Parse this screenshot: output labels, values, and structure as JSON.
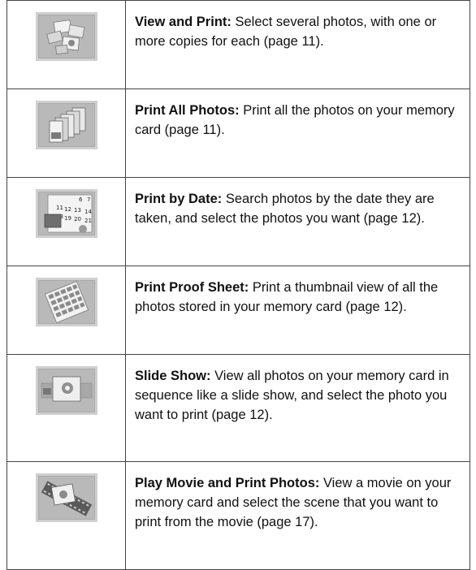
{
  "rows": [
    {
      "icon": "view-and-print-icon",
      "title": "View and Print:",
      "text": " Select several photos, with one or more copies for each (page 11)."
    },
    {
      "icon": "print-all-photos-icon",
      "title": "Print All Photos:",
      "text": " Print all the photos on your memory card (page 11)."
    },
    {
      "icon": "print-by-date-icon",
      "title": "Print by Date:",
      "text": " Search photos by the date they are taken, and select the photos you want (page 12)."
    },
    {
      "icon": "print-proof-sheet-icon",
      "title": "Print Proof Sheet:",
      "text": " Print a thumbnail view of all the photos stored in your memory card (page 12)."
    },
    {
      "icon": "slide-show-icon",
      "title": "Slide Show:",
      "text": " View all photos on your memory card in sequence like a slide show, and select the photo you want to print (page 12)."
    },
    {
      "icon": "play-movie-icon",
      "title": "Play Movie and Print Photos:",
      "text": " View a movie on your memory card and select the scene that you want to print from the movie (page 17)."
    }
  ],
  "calendar_numbers": [
    "11",
    "12",
    "13",
    "14",
    "18",
    "19",
    "20",
    "21",
    "6",
    "7"
  ]
}
